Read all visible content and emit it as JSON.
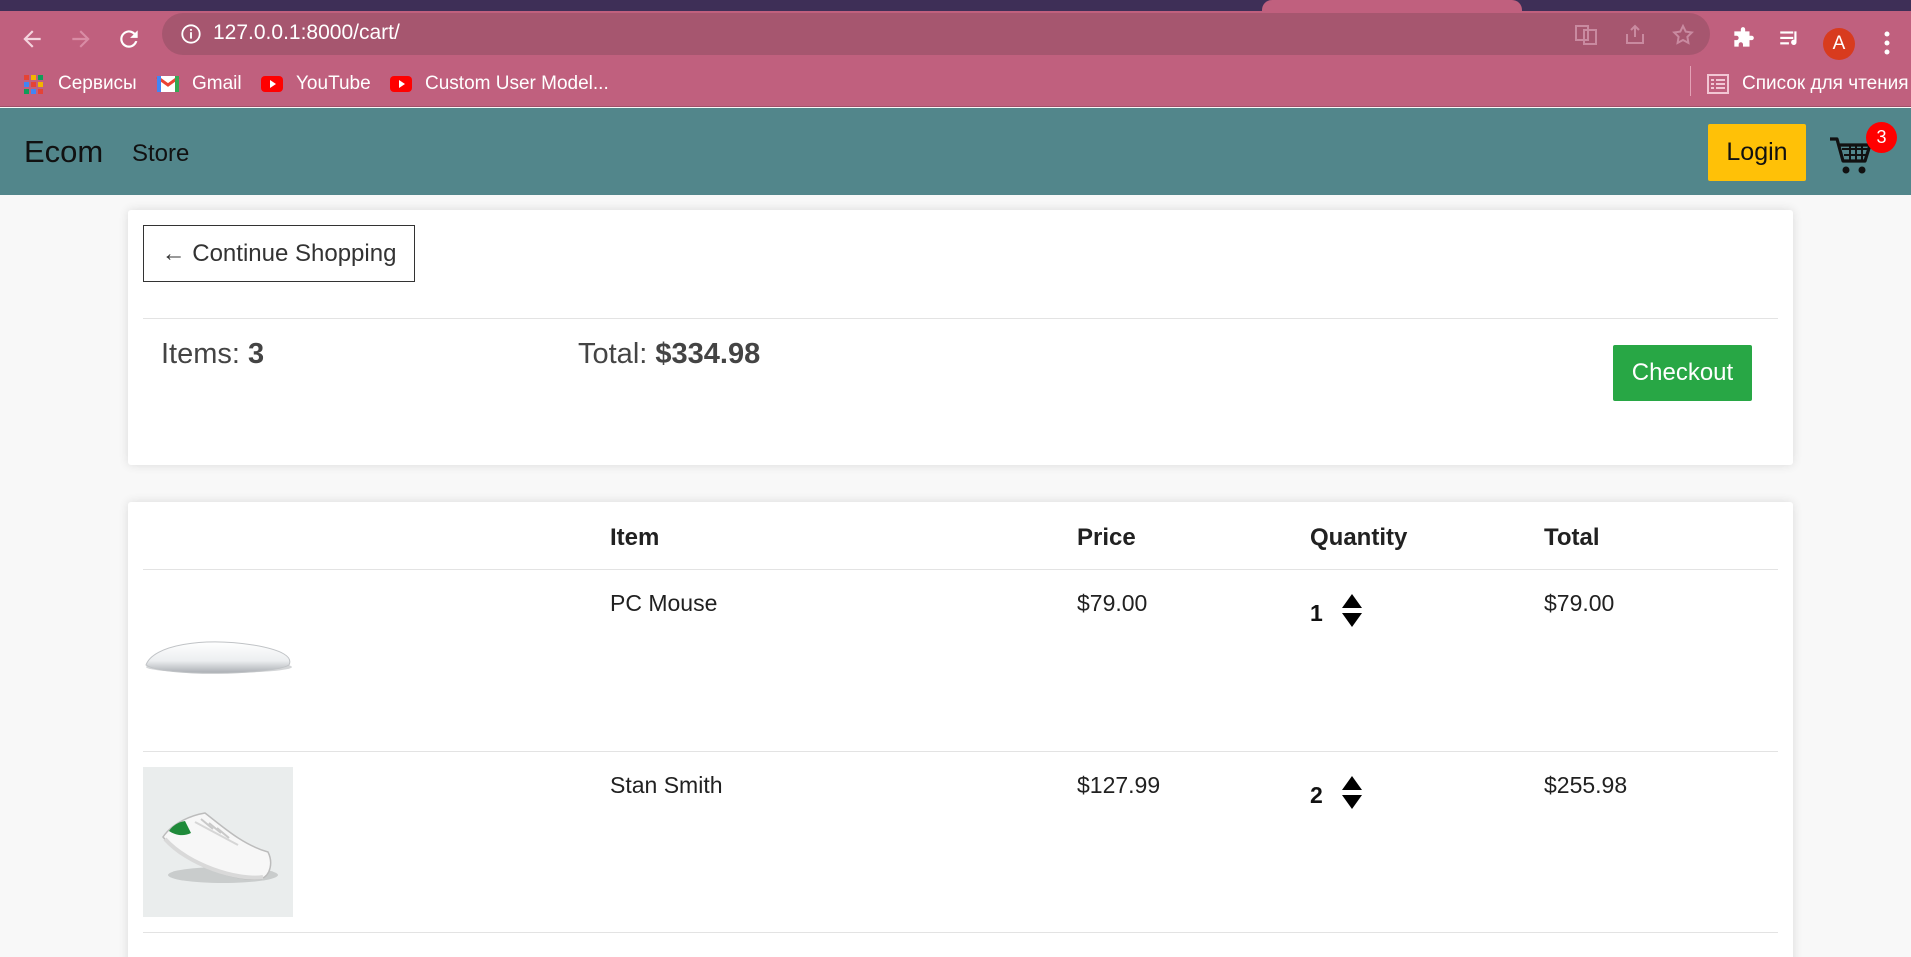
{
  "browser": {
    "url": "127.0.0.1:8000/cart/",
    "profile_initial": "A",
    "bookmarks": [
      {
        "label": "Сервисы",
        "icon": "apps-grid-icon"
      },
      {
        "label": "Gmail",
        "icon": "gmail-icon"
      },
      {
        "label": "YouTube",
        "icon": "youtube-icon"
      },
      {
        "label": "Custom User Model...",
        "icon": "youtube-icon"
      }
    ],
    "reading_list": "Список для чтения"
  },
  "navbar": {
    "brand": "Ecom",
    "store": "Store",
    "login": "Login",
    "cart_count": "3"
  },
  "summary": {
    "continue": "← Continue Shopping",
    "items_label": "Items:",
    "items_value": "3",
    "total_label": "Total:",
    "total_value": "$334.98",
    "checkout": "Checkout"
  },
  "table": {
    "headers": {
      "item": "Item",
      "price": "Price",
      "quantity": "Quantity",
      "total": "Total"
    },
    "rows": [
      {
        "name": "PC Mouse",
        "price": "$79.00",
        "quantity": "1",
        "total": "$79.00"
      },
      {
        "name": "Stan Smith",
        "price": "$127.99",
        "quantity": "2",
        "total": "$255.98"
      }
    ]
  },
  "colors": {
    "browser_chrome": "#c0607e",
    "navbar": "#52868b",
    "login": "#ffc107",
    "checkout": "#28a745",
    "badge": "#ff0000"
  }
}
